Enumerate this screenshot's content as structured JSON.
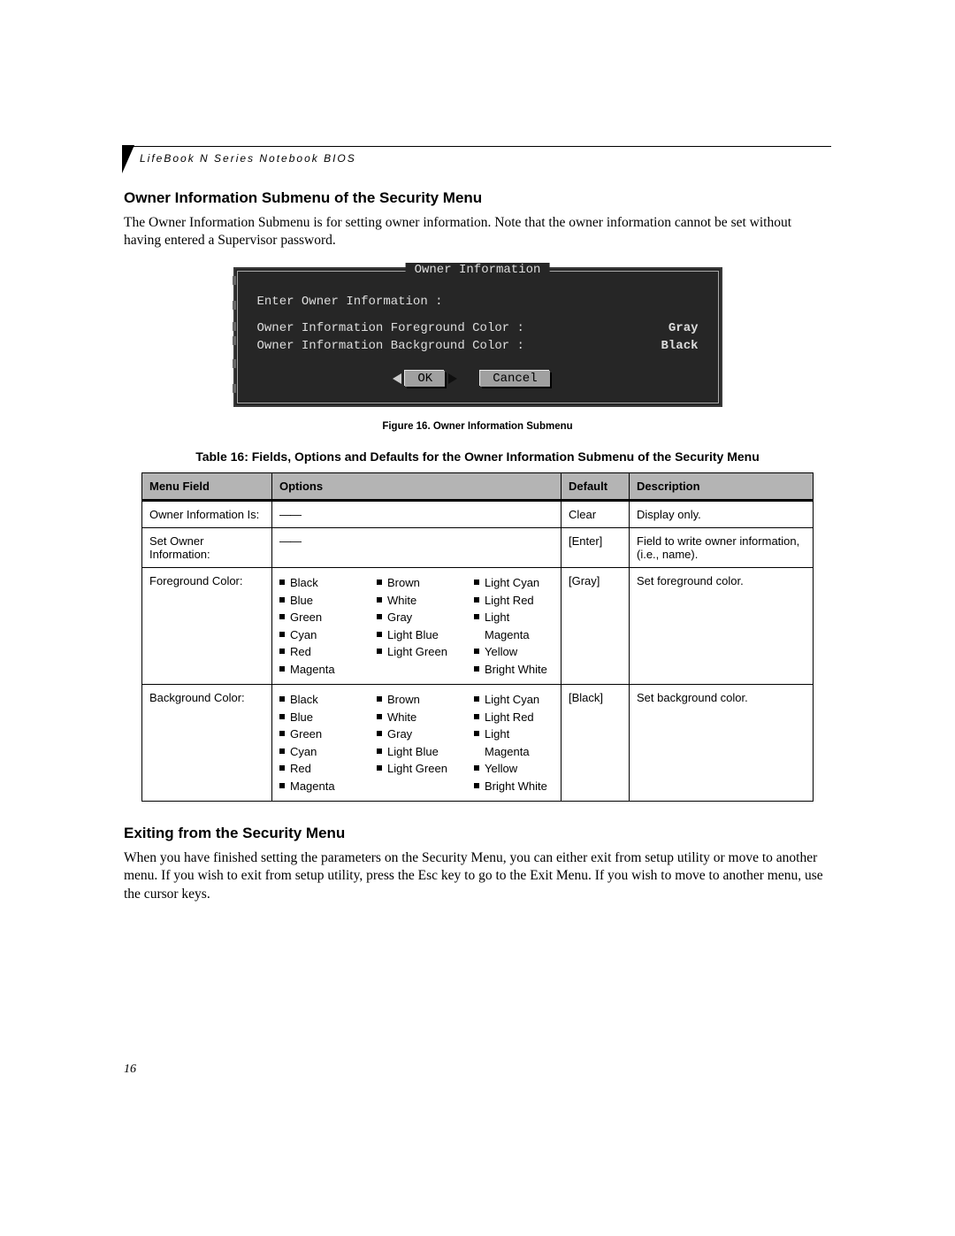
{
  "running_head": "LifeBook N Series Notebook BIOS",
  "section1": {
    "title": "Owner Information Submenu of the Security Menu",
    "body": "The Owner Information Submenu is for setting owner information. Note that the owner information cannot be set without having entered a Supervisor password."
  },
  "bios": {
    "title": "Owner Information",
    "line_enter": "Enter Owner Information :",
    "fg_label": "Owner Information Foreground Color :",
    "fg_value": "Gray",
    "bg_label": "Owner Information Background Color :",
    "bg_value": "Black",
    "ok": "OK",
    "cancel": "Cancel"
  },
  "figure_caption": "Figure 16.  Owner Information Submenu",
  "table_title": "Table 16: Fields, Options and Defaults for the Owner Information Submenu of the Security Menu",
  "table_headers": {
    "menu_field": "Menu Field",
    "options": "Options",
    "default": "Default",
    "description": "Description"
  },
  "color_cols": [
    [
      "Black",
      "Blue",
      "Green",
      "Cyan",
      "Red",
      "Magenta"
    ],
    [
      "Brown",
      "White",
      "Gray",
      "Light Blue",
      "Light Green"
    ],
    [
      "Light Cyan",
      "Light Red",
      "Light Magenta",
      "Yellow",
      "Bright White"
    ]
  ],
  "rows": [
    {
      "field": "Owner Information Is:",
      "options_dash": true,
      "default": "Clear",
      "desc": "Display only."
    },
    {
      "field": "Set Owner Information:",
      "options_dash": true,
      "default": "[Enter]",
      "desc": "Field to write owner information, (i.e., name)."
    },
    {
      "field": "Foreground Color:",
      "options_colors": true,
      "default": "[Gray]",
      "desc": "Set foreground color."
    },
    {
      "field": "Background Color:",
      "options_colors": true,
      "default": "[Black]",
      "desc": "Set background color."
    }
  ],
  "section2": {
    "title": "Exiting from the Security Menu",
    "body": "When you have finished setting the parameters on the Security Menu, you can either exit from setup utility or move to another menu. If you wish to exit from setup utility, press the Esc key to go to the Exit Menu. If you wish to move to another menu, use the cursor keys."
  },
  "page_number": "16"
}
